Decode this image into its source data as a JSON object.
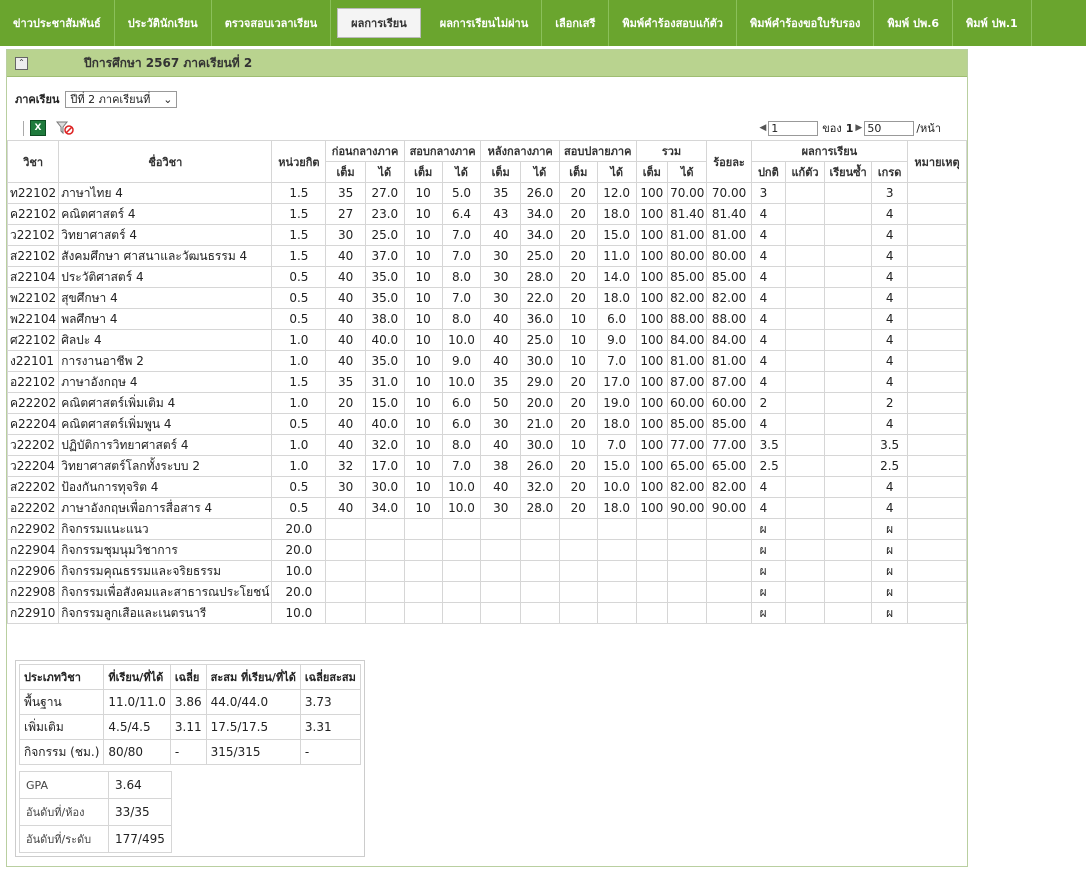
{
  "nav": {
    "tabs": [
      {
        "label": "ข่าวประชาสัมพันธ์",
        "active": false
      },
      {
        "label": "ประวัตินักเรียน",
        "active": false
      },
      {
        "label": "ตรวจสอบเวลาเรียน",
        "active": false
      },
      {
        "label": "ผลการเรียน",
        "active": true
      },
      {
        "label": "ผลการเรียนไม่ผ่าน",
        "active": false
      },
      {
        "label": "เลือกเสรี",
        "active": false
      },
      {
        "label": "พิมพ์คำร้องสอบแก้ตัว",
        "active": false
      },
      {
        "label": "พิมพ์คำร้องขอใบรับรอง",
        "active": false
      },
      {
        "label": "พิมพ์ ปพ.6",
        "active": false
      },
      {
        "label": "พิมพ์ ปพ.1",
        "active": false
      }
    ]
  },
  "panel": {
    "collapse_icon": "collapse-up-icon",
    "title": "ปีการศึกษา 2567 ภาคเรียนที่ 2"
  },
  "semester": {
    "label": "ภาคเรียน",
    "selected": "ปีที่ 2 ภาคเรียนที่"
  },
  "pager": {
    "page": "1",
    "of_label": "ของ",
    "total": "1",
    "per_page": "50",
    "per_page_label": "/หน้า"
  },
  "table": {
    "headers": {
      "code": "วิชา",
      "name": "ชื่อวิชา",
      "credit": "หน่วยกิต",
      "groups": [
        "ก่อนกลางภาค",
        "สอบกลางภาค",
        "หลังกลางภาค",
        "สอบปลายภาค",
        "รวม"
      ],
      "full": "เต็ม",
      "got": "ได้",
      "percent": "ร้อยละ",
      "result": "ผลการเรียน",
      "normal": "ปกติ",
      "retake": "แก้ตัว",
      "repeat": "เรียนซ้ำ",
      "grade": "เกรด",
      "remark": "หมายเหตุ"
    },
    "rows": [
      [
        "ท22102",
        "ภาษาไทย 4",
        "1.5",
        "35",
        "27.0",
        "10",
        "5.0",
        "35",
        "26.0",
        "20",
        "12.0",
        "100",
        "70.00",
        "70.00",
        "3",
        "",
        "",
        "3",
        ""
      ],
      [
        "ค22102",
        "คณิตศาสตร์ 4",
        "1.5",
        "27",
        "23.0",
        "10",
        "6.4",
        "43",
        "34.0",
        "20",
        "18.0",
        "100",
        "81.40",
        "81.40",
        "4",
        "",
        "",
        "4",
        ""
      ],
      [
        "ว22102",
        "วิทยาศาสตร์ 4",
        "1.5",
        "30",
        "25.0",
        "10",
        "7.0",
        "40",
        "34.0",
        "20",
        "15.0",
        "100",
        "81.00",
        "81.00",
        "4",
        "",
        "",
        "4",
        ""
      ],
      [
        "ส22102",
        "สังคมศึกษา ศาสนาและวัฒนธรรม 4",
        "1.5",
        "40",
        "37.0",
        "10",
        "7.0",
        "30",
        "25.0",
        "20",
        "11.0",
        "100",
        "80.00",
        "80.00",
        "4",
        "",
        "",
        "4",
        ""
      ],
      [
        "ส22104",
        "ประวัติศาสตร์ 4",
        "0.5",
        "40",
        "35.0",
        "10",
        "8.0",
        "30",
        "28.0",
        "20",
        "14.0",
        "100",
        "85.00",
        "85.00",
        "4",
        "",
        "",
        "4",
        ""
      ],
      [
        "พ22102",
        "สุขศึกษา 4",
        "0.5",
        "40",
        "35.0",
        "10",
        "7.0",
        "30",
        "22.0",
        "20",
        "18.0",
        "100",
        "82.00",
        "82.00",
        "4",
        "",
        "",
        "4",
        ""
      ],
      [
        "พ22104",
        "พลศึกษา 4",
        "0.5",
        "40",
        "38.0",
        "10",
        "8.0",
        "40",
        "36.0",
        "10",
        "6.0",
        "100",
        "88.00",
        "88.00",
        "4",
        "",
        "",
        "4",
        ""
      ],
      [
        "ศ22102",
        "ศิลปะ 4",
        "1.0",
        "40",
        "40.0",
        "10",
        "10.0",
        "40",
        "25.0",
        "10",
        "9.0",
        "100",
        "84.00",
        "84.00",
        "4",
        "",
        "",
        "4",
        ""
      ],
      [
        "ง22101",
        "การงานอาชีพ 2",
        "1.0",
        "40",
        "35.0",
        "10",
        "9.0",
        "40",
        "30.0",
        "10",
        "7.0",
        "100",
        "81.00",
        "81.00",
        "4",
        "",
        "",
        "4",
        ""
      ],
      [
        "อ22102",
        "ภาษาอังกฤษ 4",
        "1.5",
        "35",
        "31.0",
        "10",
        "10.0",
        "35",
        "29.0",
        "20",
        "17.0",
        "100",
        "87.00",
        "87.00",
        "4",
        "",
        "",
        "4",
        ""
      ],
      [
        "ค22202",
        "คณิตศาสตร์เพิ่มเติม 4",
        "1.0",
        "20",
        "15.0",
        "10",
        "6.0",
        "50",
        "20.0",
        "20",
        "19.0",
        "100",
        "60.00",
        "60.00",
        "2",
        "",
        "",
        "2",
        ""
      ],
      [
        "ค22204",
        "คณิตศาสตร์เพิ่มพูน 4",
        "0.5",
        "40",
        "40.0",
        "10",
        "6.0",
        "30",
        "21.0",
        "20",
        "18.0",
        "100",
        "85.00",
        "85.00",
        "4",
        "",
        "",
        "4",
        ""
      ],
      [
        "ว22202",
        "ปฏิบัติการวิทยาศาสตร์ 4",
        "1.0",
        "40",
        "32.0",
        "10",
        "8.0",
        "40",
        "30.0",
        "10",
        "7.0",
        "100",
        "77.00",
        "77.00",
        "3.5",
        "",
        "",
        "3.5",
        ""
      ],
      [
        "ว22204",
        "วิทยาศาสตร์โลกทั้งระบบ 2",
        "1.0",
        "32",
        "17.0",
        "10",
        "7.0",
        "38",
        "26.0",
        "20",
        "15.0",
        "100",
        "65.00",
        "65.00",
        "2.5",
        "",
        "",
        "2.5",
        ""
      ],
      [
        "ส22202",
        "ป้องกันการทุจริต 4",
        "0.5",
        "30",
        "30.0",
        "10",
        "10.0",
        "40",
        "32.0",
        "20",
        "10.0",
        "100",
        "82.00",
        "82.00",
        "4",
        "",
        "",
        "4",
        ""
      ],
      [
        "อ22202",
        "ภาษาอังกฤษเพื่อการสื่อสาร 4",
        "0.5",
        "40",
        "34.0",
        "10",
        "10.0",
        "30",
        "28.0",
        "20",
        "18.0",
        "100",
        "90.00",
        "90.00",
        "4",
        "",
        "",
        "4",
        ""
      ],
      [
        "ก22902",
        "กิจกรรมแนะแนว",
        "20.0",
        "",
        "",
        "",
        "",
        "",
        "",
        "",
        "",
        "",
        "",
        "",
        "ผ",
        "",
        "",
        "ผ",
        ""
      ],
      [
        "ก22904",
        "กิจกรรมชุมนุมวิชาการ",
        "20.0",
        "",
        "",
        "",
        "",
        "",
        "",
        "",
        "",
        "",
        "",
        "",
        "ผ",
        "",
        "",
        "ผ",
        ""
      ],
      [
        "ก22906",
        "กิจกรรมคุณธรรมและจริยธรรม",
        "10.0",
        "",
        "",
        "",
        "",
        "",
        "",
        "",
        "",
        "",
        "",
        "",
        "ผ",
        "",
        "",
        "ผ",
        ""
      ],
      [
        "ก22908",
        "กิจกรรมเพื่อสังคมและสาธารณประโยชน์",
        "20.0",
        "",
        "",
        "",
        "",
        "",
        "",
        "",
        "",
        "",
        "",
        "",
        "ผ",
        "",
        "",
        "ผ",
        ""
      ],
      [
        "ก22910",
        "กิจกรรมลูกเสือและเนตรนารี",
        "10.0",
        "",
        "",
        "",
        "",
        "",
        "",
        "",
        "",
        "",
        "",
        "",
        "ผ",
        "",
        "",
        "ผ",
        ""
      ]
    ]
  },
  "summary": {
    "headers": [
      "ประเภทวิชา",
      "ที่เรียน/ที่ได้",
      "เฉลี่ย",
      "สะสม ที่เรียน/ที่ได้",
      "เฉลี่ยสะสม"
    ],
    "rows": [
      [
        "พื้นฐาน",
        "11.0/11.0",
        "3.86",
        "44.0/44.0",
        "3.73"
      ],
      [
        "เพิ่มเติม",
        "4.5/4.5",
        "3.11",
        "17.5/17.5",
        "3.31"
      ],
      [
        "กิจกรรม (ชม.)",
        "80/80",
        "-",
        "315/315",
        "-"
      ]
    ],
    "gpa": [
      [
        "GPA",
        "3.64"
      ],
      [
        "อันดับที่/ห้อง",
        "33/35"
      ],
      [
        "อันดับที่/ระดับ",
        "177/495"
      ]
    ]
  }
}
